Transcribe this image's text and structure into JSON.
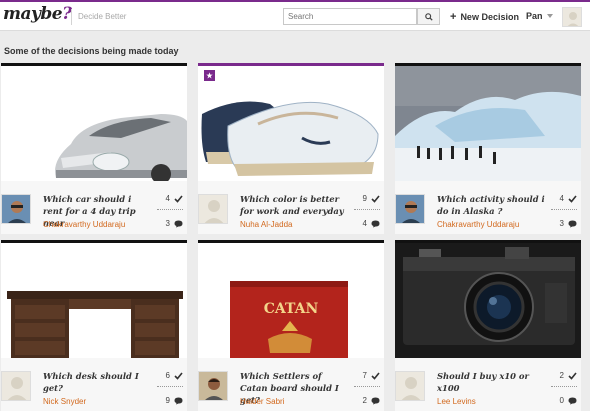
{
  "header": {
    "logo_text": "maybe",
    "logo_mark": "?",
    "tagline": "Decide Better",
    "search_placeholder": "Search",
    "new_decision_label": "New Decision",
    "user_name": "Pan"
  },
  "section_title": "Some of the decisions being made today",
  "accent_color": "#7a2a8c",
  "author_color": "#d2691e",
  "cards": [
    {
      "question": "Which car should i rent for a 4 day trip near",
      "author": "Chakravarthy Uddaraju",
      "votes": "4",
      "comments": "3",
      "featured": false,
      "image": "silver-car"
    },
    {
      "question": "Which color is better for work and everyday",
      "author": "Nuha Al-Jadda",
      "votes": "9",
      "comments": "4",
      "featured": true,
      "image": "boat-shoe"
    },
    {
      "question": "Which activity should i do in Alaska ?",
      "author": "Chakravarthy Uddaraju",
      "votes": "4",
      "comments": "3",
      "featured": false,
      "image": "glacier-hikers"
    },
    {
      "question": "Which desk should I get?",
      "author": "Nick Snyder",
      "votes": "6",
      "comments": "9",
      "featured": false,
      "image": "wooden-desk"
    },
    {
      "question": "Which Settlers of Catan board should I get?",
      "author": "Haider Sabri",
      "votes": "7",
      "comments": "2",
      "featured": false,
      "image": "catan-box",
      "box_title": "CATAN"
    },
    {
      "question": "Should I buy x10 or x100",
      "author": "Lee Levins",
      "votes": "2",
      "comments": "0",
      "featured": false,
      "image": "camera"
    }
  ]
}
